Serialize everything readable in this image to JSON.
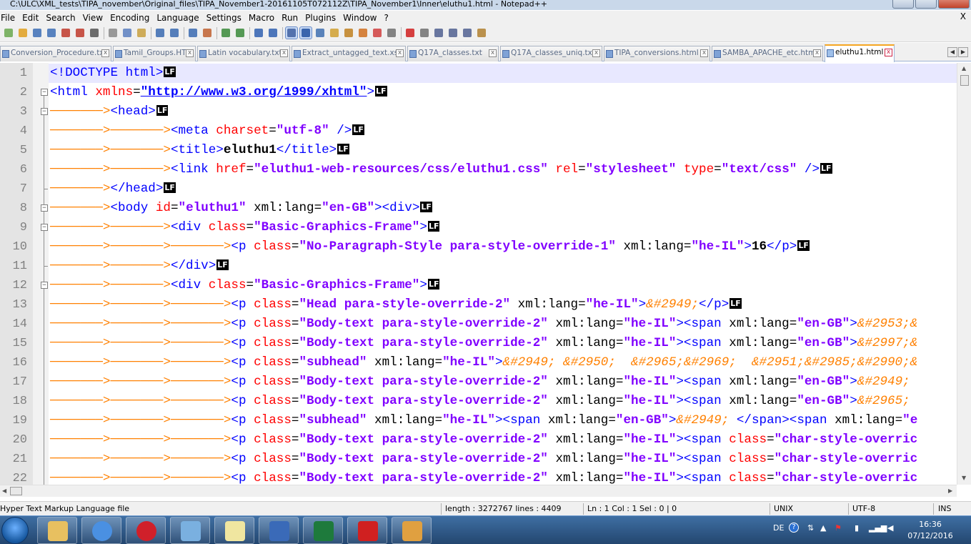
{
  "window": {
    "title": "C:\\ULC\\XML_tests\\TIPA_november\\Original_files\\TIPA_November1-20161105T072112Z\\TIPA_November1\\Inner\\eluthu1.html - Notepad++"
  },
  "menu": [
    "File",
    "Edit",
    "Search",
    "View",
    "Encoding",
    "Language",
    "Settings",
    "Macro",
    "Run",
    "Plugins",
    "Window",
    "?"
  ],
  "menu_close": "X",
  "toolbar_icons": [
    "new-file-icon",
    "open-file-icon",
    "save-icon",
    "save-all-icon",
    "close-icon",
    "close-all-icon",
    "print-icon",
    "cut-icon",
    "copy-icon",
    "paste-icon",
    "undo-icon",
    "redo-icon",
    "find-icon",
    "replace-icon",
    "zoom-in-icon",
    "zoom-out-icon",
    "sync-vertical-icon",
    "sync-horizontal-icon",
    "word-wrap-icon",
    "show-all-characters-icon",
    "indent-guide-icon",
    "user-language-icon",
    "doc-map-icon",
    "function-list-icon",
    "folder-workspace-icon",
    "monitoring-icon",
    "record-macro-icon",
    "stop-macro-icon",
    "play-macro-icon",
    "run-macro-multiple-icon",
    "save-macro-icon",
    "plugin-icon"
  ],
  "tabs": [
    {
      "label": "Conversion_Procedure.txt",
      "active": false
    },
    {
      "label": "Tamil_Groups.HTM",
      "active": false
    },
    {
      "label": "Latin vocabulary.txt",
      "active": false
    },
    {
      "label": "Extract_untagged_text.xslt",
      "active": false
    },
    {
      "label": "Q17A_classes.txt",
      "active": false
    },
    {
      "label": "Q17A_classes_uniq.txt",
      "active": false
    },
    {
      "label": "TIPA_conversions.html",
      "active": false
    },
    {
      "label": "SAMBA_APACHE_etc.html",
      "active": false
    },
    {
      "label": "eluthu1.html",
      "active": true
    }
  ],
  "tab_close": "x",
  "lf_marker": "LF",
  "editor": {
    "lines": [
      {
        "n": "1",
        "indent": 0,
        "parts": [
          [
            "tag",
            "<!DOCTYPE html>"
          ]
        ],
        "lf": true
      },
      {
        "n": "2",
        "indent": 0,
        "parts": [
          [
            "tag",
            "<html "
          ],
          [
            "att",
            "xmlns"
          ],
          [
            "plain",
            "="
          ],
          [
            "url",
            "\"http://www.w3.org/1999/xhtml\""
          ],
          [
            "tag",
            ">"
          ]
        ],
        "lf": true
      },
      {
        "n": "3",
        "indent": 1,
        "parts": [
          [
            "tag",
            "<head>"
          ]
        ],
        "lf": true
      },
      {
        "n": "4",
        "indent": 2,
        "parts": [
          [
            "tag",
            "<meta "
          ],
          [
            "att",
            "charset"
          ],
          [
            "plain",
            "="
          ],
          [
            "val",
            "\"utf-8\""
          ],
          [
            "tag",
            " />"
          ]
        ],
        "lf": true
      },
      {
        "n": "5",
        "indent": 2,
        "parts": [
          [
            "tag",
            "<title>"
          ],
          [
            "txt",
            "eluthu1"
          ],
          [
            "tag",
            "</title>"
          ]
        ],
        "lf": true
      },
      {
        "n": "6",
        "indent": 2,
        "parts": [
          [
            "tag",
            "<link "
          ],
          [
            "att",
            "href"
          ],
          [
            "plain",
            "="
          ],
          [
            "val",
            "\"eluthu1-web-resources/css/eluthu1.css\""
          ],
          [
            "tag",
            " "
          ],
          [
            "att",
            "rel"
          ],
          [
            "plain",
            "="
          ],
          [
            "val",
            "\"stylesheet\""
          ],
          [
            "tag",
            " "
          ],
          [
            "att",
            "type"
          ],
          [
            "plain",
            "="
          ],
          [
            "val",
            "\"text/css\""
          ],
          [
            "tag",
            " />"
          ]
        ],
        "lf": true
      },
      {
        "n": "7",
        "indent": 1,
        "parts": [
          [
            "tag",
            "</head>"
          ]
        ],
        "lf": true
      },
      {
        "n": "8",
        "indent": 1,
        "parts": [
          [
            "tag",
            "<body "
          ],
          [
            "att",
            "id"
          ],
          [
            "plain",
            "="
          ],
          [
            "val",
            "\"eluthu1\""
          ],
          [
            "tag",
            " "
          ],
          [
            "plain",
            "xml:lang="
          ],
          [
            "val",
            "\"en-GB\""
          ],
          [
            "tag",
            "><div>"
          ]
        ],
        "lf": true
      },
      {
        "n": "9",
        "indent": 2,
        "parts": [
          [
            "tag",
            "<div "
          ],
          [
            "att",
            "class"
          ],
          [
            "plain",
            "="
          ],
          [
            "val",
            "\"Basic-Graphics-Frame\""
          ],
          [
            "tag",
            ">"
          ]
        ],
        "lf": true
      },
      {
        "n": "10",
        "indent": 3,
        "parts": [
          [
            "tag",
            "<p "
          ],
          [
            "att",
            "class"
          ],
          [
            "plain",
            "="
          ],
          [
            "val",
            "\"No-Paragraph-Style para-style-override-1\""
          ],
          [
            "tag",
            " "
          ],
          [
            "plain",
            "xml:lang="
          ],
          [
            "val",
            "\"he-IL\""
          ],
          [
            "tag",
            ">"
          ],
          [
            "txt",
            "16"
          ],
          [
            "tag",
            "</p>"
          ]
        ],
        "lf": true
      },
      {
        "n": "11",
        "indent": 2,
        "parts": [
          [
            "tag",
            "</div>"
          ]
        ],
        "lf": true
      },
      {
        "n": "12",
        "indent": 2,
        "parts": [
          [
            "tag",
            "<div "
          ],
          [
            "att",
            "class"
          ],
          [
            "plain",
            "="
          ],
          [
            "val",
            "\"Basic-Graphics-Frame\""
          ],
          [
            "tag",
            ">"
          ]
        ],
        "lf": true
      },
      {
        "n": "13",
        "indent": 3,
        "parts": [
          [
            "tag",
            "<p "
          ],
          [
            "att",
            "class"
          ],
          [
            "plain",
            "="
          ],
          [
            "val",
            "\"Head para-style-override-2\""
          ],
          [
            "tag",
            " "
          ],
          [
            "plain",
            "xml:lang="
          ],
          [
            "val",
            "\"he-IL\""
          ],
          [
            "tag",
            ">"
          ],
          [
            "ent",
            "&#2949;"
          ],
          [
            "tag",
            "</p>"
          ]
        ],
        "lf": true
      },
      {
        "n": "14",
        "indent": 3,
        "parts": [
          [
            "tag",
            "<p "
          ],
          [
            "att",
            "class"
          ],
          [
            "plain",
            "="
          ],
          [
            "val",
            "\"Body-text para-style-override-2\""
          ],
          [
            "tag",
            " "
          ],
          [
            "plain",
            "xml:lang="
          ],
          [
            "val",
            "\"he-IL\""
          ],
          [
            "tag",
            "><span "
          ],
          [
            "plain",
            "xml:lang="
          ],
          [
            "val",
            "\"en-GB\""
          ],
          [
            "tag",
            ">"
          ],
          [
            "ent",
            "&#2953;&"
          ]
        ],
        "lf": false
      },
      {
        "n": "15",
        "indent": 3,
        "parts": [
          [
            "tag",
            "<p "
          ],
          [
            "att",
            "class"
          ],
          [
            "plain",
            "="
          ],
          [
            "val",
            "\"Body-text para-style-override-2\""
          ],
          [
            "tag",
            " "
          ],
          [
            "plain",
            "xml:lang="
          ],
          [
            "val",
            "\"he-IL\""
          ],
          [
            "tag",
            "><span "
          ],
          [
            "plain",
            "xml:lang="
          ],
          [
            "val",
            "\"en-GB\""
          ],
          [
            "tag",
            ">"
          ],
          [
            "ent",
            "&#2997;&"
          ]
        ],
        "lf": false
      },
      {
        "n": "16",
        "indent": 3,
        "parts": [
          [
            "tag",
            "<p "
          ],
          [
            "att",
            "class"
          ],
          [
            "plain",
            "="
          ],
          [
            "val",
            "\"subhead\""
          ],
          [
            "tag",
            " "
          ],
          [
            "plain",
            "xml:lang="
          ],
          [
            "val",
            "\"he-IL\""
          ],
          [
            "tag",
            ">"
          ],
          [
            "ent",
            "&#2949; &#2950;  &#2965;&#2969;  &#2951;&#2985;&#2990;&"
          ]
        ],
        "lf": false
      },
      {
        "n": "17",
        "indent": 3,
        "parts": [
          [
            "tag",
            "<p "
          ],
          [
            "att",
            "class"
          ],
          [
            "plain",
            "="
          ],
          [
            "val",
            "\"Body-text para-style-override-2\""
          ],
          [
            "tag",
            " "
          ],
          [
            "plain",
            "xml:lang="
          ],
          [
            "val",
            "\"he-IL\""
          ],
          [
            "tag",
            "><span "
          ],
          [
            "plain",
            "xml:lang="
          ],
          [
            "val",
            "\"en-GB\""
          ],
          [
            "tag",
            ">"
          ],
          [
            "ent",
            "&#2949; "
          ]
        ],
        "lf": false
      },
      {
        "n": "18",
        "indent": 3,
        "parts": [
          [
            "tag",
            "<p "
          ],
          [
            "att",
            "class"
          ],
          [
            "plain",
            "="
          ],
          [
            "val",
            "\"Body-text para-style-override-2\""
          ],
          [
            "tag",
            " "
          ],
          [
            "plain",
            "xml:lang="
          ],
          [
            "val",
            "\"he-IL\""
          ],
          [
            "tag",
            "><span "
          ],
          [
            "plain",
            "xml:lang="
          ],
          [
            "val",
            "\"en-GB\""
          ],
          [
            "tag",
            ">"
          ],
          [
            "ent",
            "&#2965; "
          ]
        ],
        "lf": false
      },
      {
        "n": "19",
        "indent": 3,
        "parts": [
          [
            "tag",
            "<p "
          ],
          [
            "att",
            "class"
          ],
          [
            "plain",
            "="
          ],
          [
            "val",
            "\"subhead\""
          ],
          [
            "tag",
            " "
          ],
          [
            "plain",
            "xml:lang="
          ],
          [
            "val",
            "\"he-IL\""
          ],
          [
            "tag",
            "><span "
          ],
          [
            "plain",
            "xml:lang="
          ],
          [
            "val",
            "\"en-GB\""
          ],
          [
            "tag",
            ">"
          ],
          [
            "ent",
            "&#2949; "
          ],
          [
            "tag",
            "</span><span "
          ],
          [
            "plain",
            "xml:lang="
          ],
          [
            "val",
            "\"e"
          ]
        ],
        "lf": false
      },
      {
        "n": "20",
        "indent": 3,
        "parts": [
          [
            "tag",
            "<p "
          ],
          [
            "att",
            "class"
          ],
          [
            "plain",
            "="
          ],
          [
            "val",
            "\"Body-text para-style-override-2\""
          ],
          [
            "tag",
            " "
          ],
          [
            "plain",
            "xml:lang="
          ],
          [
            "val",
            "\"he-IL\""
          ],
          [
            "tag",
            "><span "
          ],
          [
            "att",
            "class"
          ],
          [
            "plain",
            "="
          ],
          [
            "val",
            "\"char-style-overric"
          ]
        ],
        "lf": false
      },
      {
        "n": "21",
        "indent": 3,
        "parts": [
          [
            "tag",
            "<p "
          ],
          [
            "att",
            "class"
          ],
          [
            "plain",
            "="
          ],
          [
            "val",
            "\"Body-text para-style-override-2\""
          ],
          [
            "tag",
            " "
          ],
          [
            "plain",
            "xml:lang="
          ],
          [
            "val",
            "\"he-IL\""
          ],
          [
            "tag",
            "><span "
          ],
          [
            "att",
            "class"
          ],
          [
            "plain",
            "="
          ],
          [
            "val",
            "\"char-style-overric"
          ]
        ],
        "lf": false
      },
      {
        "n": "22",
        "indent": 3,
        "parts": [
          [
            "tag",
            "<p "
          ],
          [
            "att",
            "class"
          ],
          [
            "plain",
            "="
          ],
          [
            "val",
            "\"Body-text para-style-override-2\""
          ],
          [
            "tag",
            " "
          ],
          [
            "plain",
            "xml:lang="
          ],
          [
            "val",
            "\"he-IL\""
          ],
          [
            "tag",
            "><span "
          ],
          [
            "att",
            "class"
          ],
          [
            "plain",
            "="
          ],
          [
            "val",
            "\"char-style-overric"
          ]
        ],
        "lf": false
      }
    ]
  },
  "status": {
    "file_type": "Hyper Text Markup Language file",
    "length_lines": "length : 3272767    lines : 4409",
    "position": "Ln : 1    Col : 1    Sel : 0 | 0",
    "eol": "UNIX",
    "encoding": "UTF-8",
    "mode": "INS"
  },
  "taskbar": {
    "apps": [
      "explorer-icon",
      "chrome-icon",
      "opera-icon",
      "app-icon",
      "notepadpp-icon",
      "thunderbird-icon",
      "excel-icon",
      "foxit-icon",
      "paint-icon"
    ],
    "language": "DE",
    "time": "16:36",
    "date": "07/12/2016"
  },
  "colors": {
    "tag": "#0000ff",
    "attribute": "#ff0000",
    "value": "#8000ff",
    "entity": "#ff8000",
    "current_line": "#e8e8ff",
    "active_tab_accent": "#f5a623"
  }
}
